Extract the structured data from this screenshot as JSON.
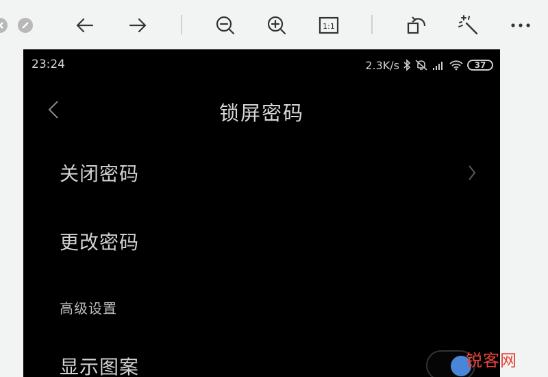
{
  "viewer": {
    "buttons": [
      {
        "name": "back-arrow-button",
        "icon": "arrow-left-icon"
      },
      {
        "name": "forward-arrow-button",
        "icon": "arrow-right-icon"
      },
      {
        "name": "zoom-out-button",
        "icon": "zoom-out-icon"
      },
      {
        "name": "zoom-in-button",
        "icon": "zoom-in-icon"
      },
      {
        "name": "actual-size-button",
        "icon": "actual-size-icon"
      },
      {
        "name": "rotate-button",
        "icon": "rotate-icon"
      },
      {
        "name": "enhance-button",
        "icon": "magic-wand-icon"
      },
      {
        "name": "more-button",
        "icon": "more-icon"
      }
    ],
    "actual_size_label": "1:1",
    "more_label": "•••"
  },
  "status_bar": {
    "time": "23:24",
    "network_speed": "2.3K/s",
    "battery": "37",
    "icons": [
      "bluetooth-icon",
      "mute-icon",
      "signal-icon",
      "wifi-icon",
      "battery-icon"
    ]
  },
  "page": {
    "title": "锁屏密码",
    "back_icon": "chevron-left-icon"
  },
  "items": {
    "close_password": "关闭密码",
    "change_password": "更改密码"
  },
  "advanced": {
    "section_title": "高级设置",
    "show_pattern": "显示图案",
    "show_pattern_enabled": true
  },
  "watermark": "锐客网",
  "colors": {
    "screen_bg": "#000000",
    "toggle_on": "#4a86d8",
    "watermark": "#e8443a"
  }
}
